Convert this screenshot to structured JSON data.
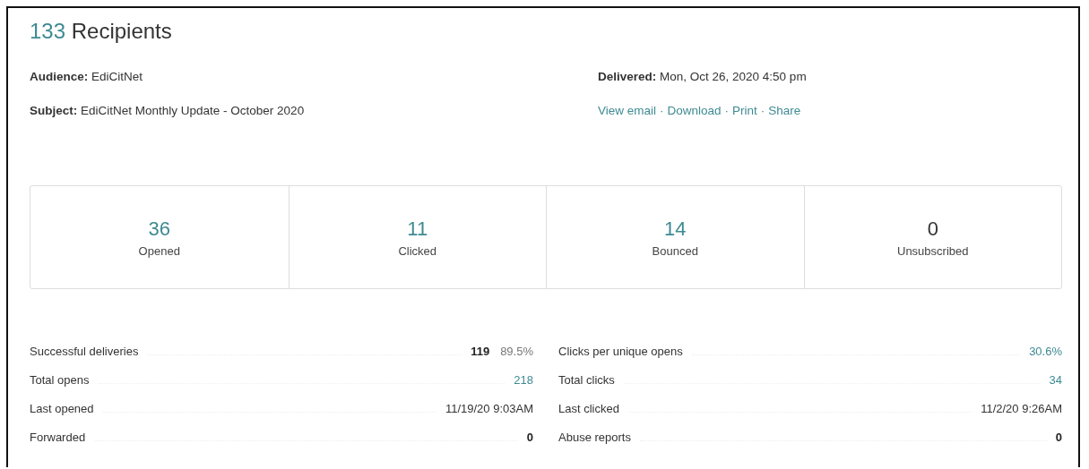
{
  "header": {
    "count": "133",
    "title": "Recipients"
  },
  "details": [
    {
      "label": "Audience:",
      "value": "EdiCitNet"
    },
    {
      "label": "Subject:",
      "value": "EdiCitNet Monthly Update - October 2020"
    },
    {
      "label": "Delivered:",
      "value": "Mon, Oct 26, 2020 4:50 pm"
    }
  ],
  "actions": {
    "separator": "·",
    "items": [
      "View email",
      "Download",
      "Print",
      "Share"
    ]
  },
  "summary": [
    {
      "value": "36",
      "label": "Opened",
      "link": true
    },
    {
      "value": "11",
      "label": "Clicked",
      "link": true
    },
    {
      "value": "14",
      "label": "Bounced",
      "link": true
    },
    {
      "value": "0",
      "label": "Unsubscribed",
      "link": false
    }
  ],
  "stats_left": [
    {
      "label": "Successful deliveries",
      "kind": "count",
      "value": "119",
      "percent": "89.5%"
    },
    {
      "label": "Total opens",
      "kind": "link",
      "value": "218"
    },
    {
      "label": "Last opened",
      "kind": "plain",
      "value": "11/19/20 9:03AM"
    },
    {
      "label": "Forwarded",
      "kind": "count",
      "value": "0"
    }
  ],
  "stats_right": [
    {
      "label": "Clicks per unique opens",
      "kind": "link",
      "value": "30.6%"
    },
    {
      "label": "Total clicks",
      "kind": "link",
      "value": "34"
    },
    {
      "label": "Last clicked",
      "kind": "plain",
      "value": "11/2/20 9:26AM"
    },
    {
      "label": "Abuse reports",
      "kind": "count",
      "value": "0"
    }
  ]
}
